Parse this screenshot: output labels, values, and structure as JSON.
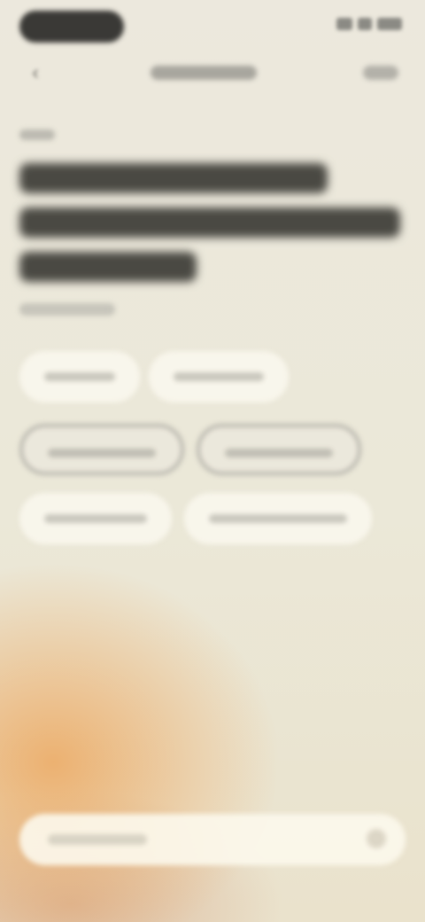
{
  "colors": {
    "background": "#ebe8d8",
    "accent_glow": "#eca860",
    "chip_background": "#faf8ee",
    "chip_selected_border": "#b9b7ae",
    "text_dark": "#4a4943"
  },
  "icons": {
    "back": "chevron-left-icon",
    "send": "send-icon"
  },
  "chips": [
    {
      "selected": false
    },
    {
      "selected": false
    },
    {
      "selected": true
    },
    {
      "selected": true
    },
    {
      "selected": false
    },
    {
      "selected": false
    }
  ]
}
